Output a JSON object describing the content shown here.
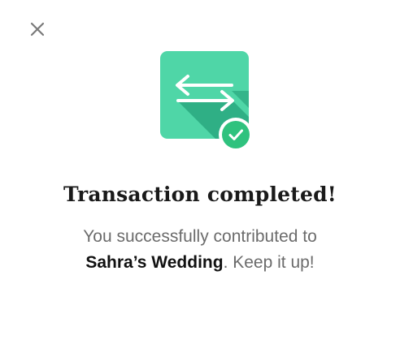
{
  "dialog": {
    "close_icon": "close-icon",
    "hero_icon": "transfer-arrows-icon",
    "badge_icon": "check-icon",
    "title": "Transaction completed!",
    "message": {
      "line1": "You successfully contributed to",
      "recipient": "Sahra’s Wedding",
      "suffix": ". Keep it up!"
    }
  },
  "colors": {
    "card": "#4fd6a7",
    "card_shadow": "#2faf85",
    "badge": "#2fc27e",
    "close": "#7a7a7a"
  }
}
